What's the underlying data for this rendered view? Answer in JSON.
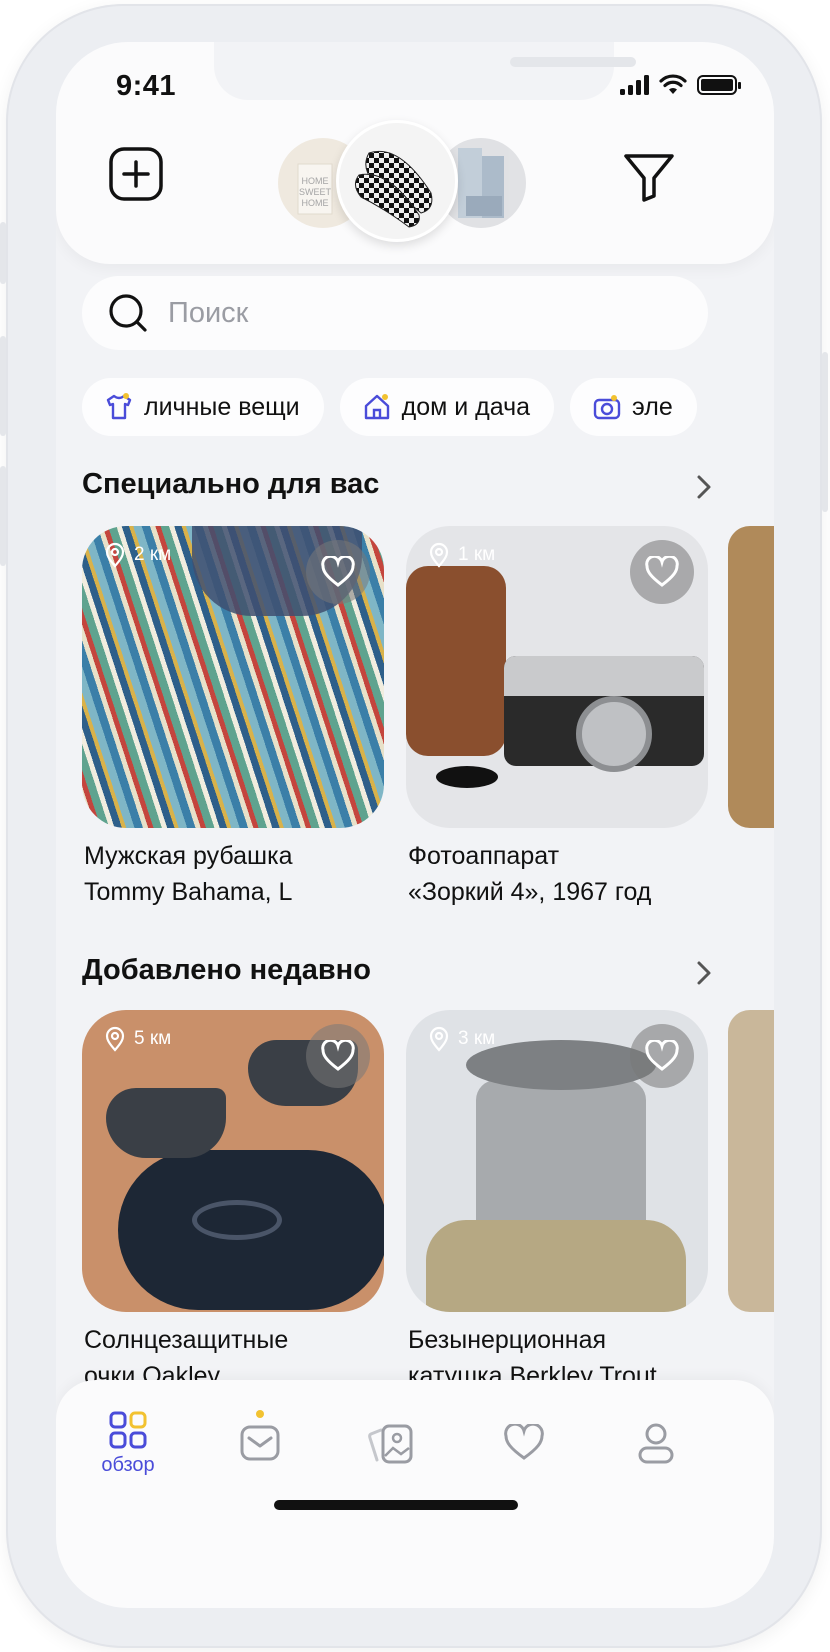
{
  "status_bar": {
    "time": "9:41"
  },
  "header": {
    "add_icon": "plus-square-icon",
    "filter_icon": "filter-icon"
  },
  "search": {
    "placeholder": "Поиск",
    "value": ""
  },
  "categories": [
    {
      "label": "личные вещи",
      "icon": "shirt-icon"
    },
    {
      "label": "дом и дача",
      "icon": "house-icon"
    },
    {
      "label": "эле",
      "icon": "camera-icon"
    }
  ],
  "sections": {
    "for_you": {
      "title": "Специально для вас",
      "items": [
        {
          "distance": "2 км",
          "title_line1": "Мужская рубашка",
          "title_line2": "Tommy Bahama, L"
        },
        {
          "distance": "1 км",
          "title_line1": "Фотоаппарат",
          "title_line2": "«Зоркий 4», 1967 год"
        }
      ]
    },
    "recent": {
      "title": "Добавлено недавно",
      "items": [
        {
          "distance": "5 км",
          "title_line1": "Солнцезащитные",
          "title_line2": "очки Oakley"
        },
        {
          "distance": "3 км",
          "title_line1": "Безынерционная",
          "title_line2": "катушка Berkley Trout"
        }
      ]
    }
  },
  "tabbar": {
    "tabs": [
      {
        "label": "обзор",
        "icon": "grid-icon",
        "active": true
      },
      {
        "label": "",
        "icon": "messages-icon",
        "badge": true
      },
      {
        "label": "",
        "icon": "cards-icon"
      },
      {
        "label": "",
        "icon": "heart-icon"
      },
      {
        "label": "",
        "icon": "profile-icon"
      }
    ]
  },
  "colors": {
    "accent": "#4a4cd9",
    "badge": "#f2c230",
    "background": "#f2f3f6"
  }
}
